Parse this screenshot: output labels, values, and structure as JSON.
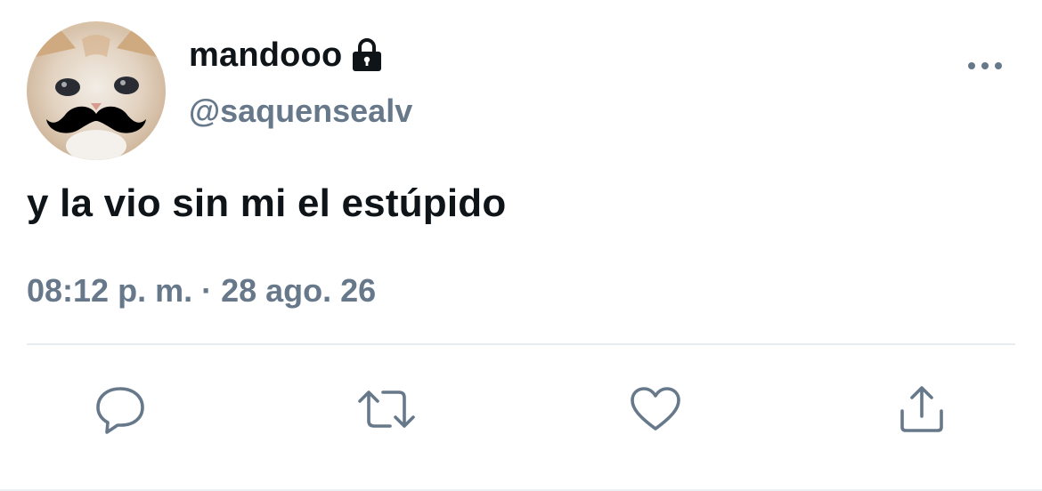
{
  "user": {
    "display_name": "mandooo",
    "handle": "@saquensealv",
    "protected_icon": "lock-icon",
    "avatar": "cat-with-mustache-avatar"
  },
  "tweet": {
    "text": "y la vio sin mi el estúpido",
    "time": "08:12 p. m.",
    "separator": "·",
    "date": "28 ago. 26"
  },
  "actions": {
    "reply_icon": "reply-icon",
    "retweet_icon": "retweet-icon",
    "like_icon": "heart-icon",
    "share_icon": "share-icon",
    "more_icon": "more-icon"
  },
  "colors": {
    "text": "#0f1419",
    "secondary": "#66788a",
    "icon": "#66788a",
    "divider": "#e6ecf0"
  }
}
